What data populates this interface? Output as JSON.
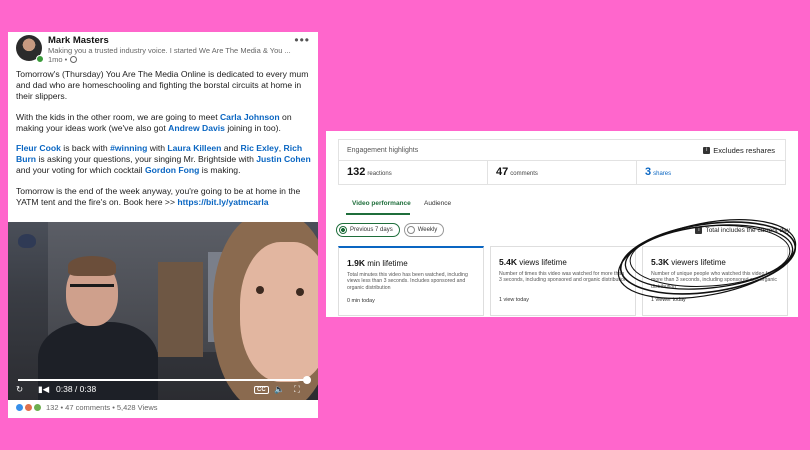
{
  "post": {
    "author": "Mark Masters",
    "headline": "Making you a trusted industry voice. I started We Are The Media & You ...",
    "time": "1mo •",
    "p1": "Tomorrow's (Thursday) You Are The Media Online is dedicated to every mum and dad who are homeschooling and fighting the borstal circuits at home in their slippers.",
    "p2a": "With the kids in the other room, we are going to meet ",
    "p2_carla": "Carla Johnson",
    "p2b": " on making your ideas work (we've also got ",
    "p2_andrew": "Andrew Davis",
    "p2c": " joining in too).",
    "p3_fleur": "Fleur Cook",
    "p3a": " is back with ",
    "p3_tag": "#winning",
    "p3b": " with ",
    "p3_laura": "Laura Killeen",
    "p3c": " and ",
    "p3_ric": "Ric Exley",
    "p3d": ", ",
    "p3_rich": "Rich Burn",
    "p3e": " is asking your questions, your singing Mr. Brightside with ",
    "p3_justin": "Justin Cohen",
    "p3f": " and your voting for which cocktail ",
    "p3_gordon": "Gordon Fong",
    "p3g": " is making.",
    "p4": "Tomorrow is the end of the week anyway, you're going to be at home in the YATM tent and the fire's on. Book here >> ",
    "p4_link": "https://bit.ly/yatmcarla",
    "video_time": "0:38 / 0:38",
    "video_progress": 1.0,
    "cc_label": "CC",
    "reaction_count": "132",
    "comments": "47 comments",
    "views": "5,428 Views",
    "footer_sep": "•"
  },
  "analytics": {
    "section_title": "Engagement highlights",
    "excludes": "Excludes reshares",
    "stats": [
      {
        "num": "132",
        "label": "reactions"
      },
      {
        "num": "47",
        "label": "comments"
      },
      {
        "num": "3",
        "label": "shares"
      }
    ],
    "tabs": [
      "Video performance",
      "Audience"
    ],
    "ranges": [
      "Previous 7 days",
      "Weekly"
    ],
    "selected_range": "Previous 7 days",
    "total_note": "Total includes the current day",
    "metrics": [
      {
        "value": "1.9K",
        "unit": "min lifetime",
        "desc": "Total minutes this video has been watched, including views less than 3 seconds. Includes sponsored and organic distribution",
        "foot": "0 min today"
      },
      {
        "value": "5.4K",
        "unit": "views lifetime",
        "desc": "Number of times this video was watched for more than 3 seconds, including sponsored and organic distribution",
        "foot": "1 view today"
      },
      {
        "value": "5.3K",
        "unit": "viewers lifetime",
        "desc": "Number of unique people who watched this video for more than 3 seconds, including sponsored and organic distribution",
        "foot": "1 viewer today"
      }
    ]
  },
  "colors": {
    "background": "#ff66cc",
    "link": "#0a66c2",
    "accent_green": "#1f6e3b"
  }
}
